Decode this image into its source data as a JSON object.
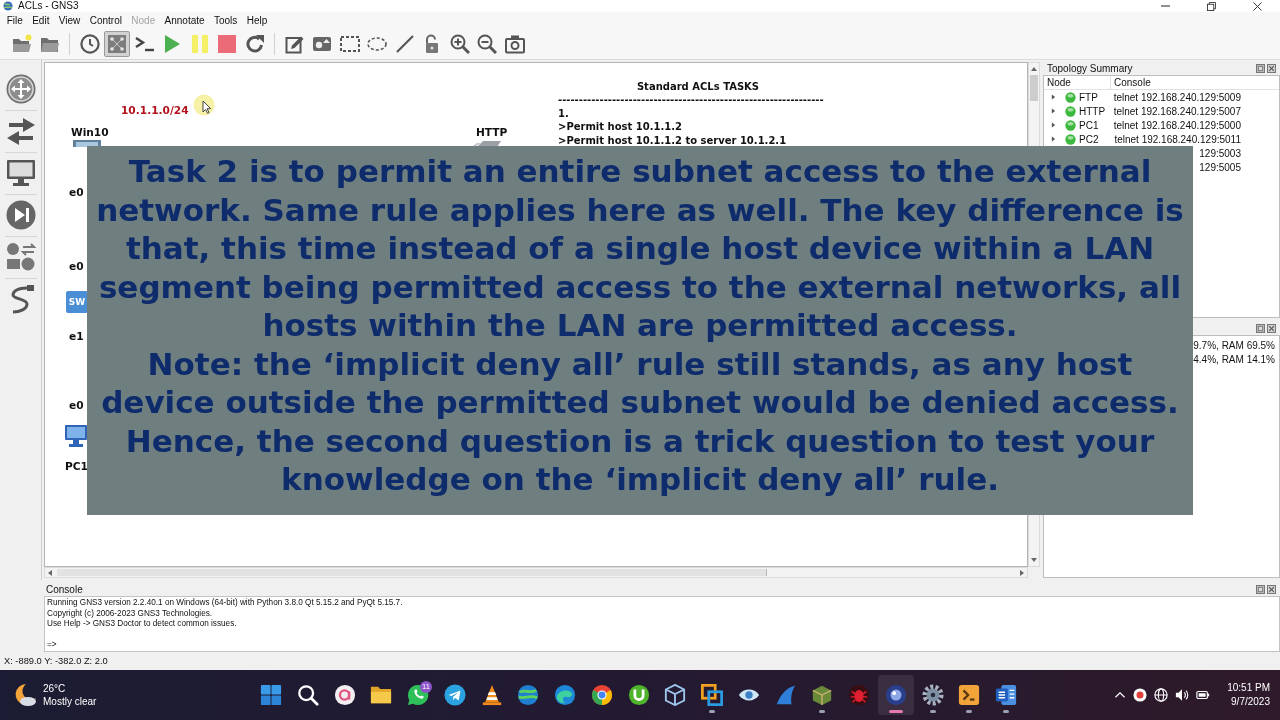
{
  "window": {
    "title": "ACLs - GNS3"
  },
  "menu": [
    {
      "label": "File",
      "disabled": false
    },
    {
      "label": "Edit",
      "disabled": false
    },
    {
      "label": "View",
      "disabled": false
    },
    {
      "label": "Control",
      "disabled": false
    },
    {
      "label": "Node",
      "disabled": true
    },
    {
      "label": "Annotate",
      "disabled": false
    },
    {
      "label": "Tools",
      "disabled": false
    },
    {
      "label": "Help",
      "disabled": false
    }
  ],
  "toolbar": [
    {
      "kind": "open",
      "pressed": false
    },
    {
      "kind": "folder",
      "pressed": false
    },
    {
      "kind": "clock",
      "pressed": false
    },
    {
      "kind": "labels",
      "pressed": true
    },
    {
      "kind": "console",
      "pressed": false
    },
    {
      "kind": "start",
      "pressed": false
    },
    {
      "kind": "pause",
      "pressed": false
    },
    {
      "kind": "stop",
      "pressed": false
    },
    {
      "kind": "reload",
      "pressed": false
    },
    {
      "kind": "note",
      "pressed": false
    },
    {
      "kind": "image",
      "pressed": false
    },
    {
      "kind": "rectangle",
      "pressed": false
    },
    {
      "kind": "ellipse",
      "pressed": false
    },
    {
      "kind": "line",
      "pressed": false
    },
    {
      "kind": "lock",
      "pressed": false
    },
    {
      "kind": "zoomin",
      "pressed": false
    },
    {
      "kind": "zoomout",
      "pressed": false
    },
    {
      "kind": "screenshot",
      "pressed": false
    }
  ],
  "canvas": {
    "items": [
      {
        "kind": "note",
        "text": "10.1.1.0/24"
      },
      {
        "kind": "label",
        "text": "Win10"
      },
      {
        "kind": "label",
        "text": "HTTP"
      },
      {
        "kind": "port",
        "text": "e0"
      },
      {
        "kind": "port",
        "text": "e0"
      },
      {
        "kind": "switch",
        "text": "SW"
      },
      {
        "kind": "port",
        "text": "e1"
      },
      {
        "kind": "port",
        "text": "e0"
      },
      {
        "kind": "label",
        "text": "PC1"
      }
    ],
    "tasks": {
      "title": "Standard ACLs TASKS",
      "rule": "----------------------------------------------------------------",
      "lines": [
        "1.",
        ">Permit host 10.1.1.2",
        ">Permit host 10.1.1.2 to server 10.1.2.1"
      ]
    }
  },
  "caption": {
    "paragraphs": [
      "Task 2 is to permit an entire subnet access to the external network. Same rule applies here as well. The key difference is that, this time instead of a single host device within a LAN segment being permitted access to the external networks, all hosts within the LAN are permitted access.",
      "Note: the ‘implicit deny all’ rule still stands, as any host device outside the permitted subnet would be denied access. Hence, the second question is a trick question to test your knowledge on the ‘implicit deny all’ rule."
    ]
  },
  "topology": {
    "title": "Topology Summary",
    "columns": [
      "Node",
      "Console"
    ],
    "rows": [
      {
        "node": "FTP",
        "console": "telnet 192.168.240.129:5009",
        "running": true,
        "expanded": false
      },
      {
        "node": "HTTP",
        "console": "telnet 192.168.240.129:5007",
        "running": true,
        "expanded": false
      },
      {
        "node": "PC1",
        "console": "telnet 192.168.240.129:5000",
        "running": true,
        "expanded": false
      },
      {
        "node": "PC2",
        "console": "telnet 192.168.240.129:5011",
        "running": true,
        "expanded": false
      },
      {
        "console": "129:5003"
      },
      {
        "console": "129:5005"
      }
    ]
  },
  "servers": {
    "rows": [
      "9.7%, RAM 69.5%",
      "4.4%, RAM 14.1%"
    ]
  },
  "console": {
    "title": "Console",
    "lines": [
      "Running GNS3 version 2.2.40.1 on Windows (64-bit) with Python 3.8.0 Qt 5.15.2 and PyQt 5.15.7.",
      "Copyright (c) 2006-2023 GNS3 Technologies.",
      "Use Help -> GNS3 Doctor to detect common issues."
    ],
    "prompt": "=>"
  },
  "status_bar": "X: -889.0 Y: -382.0 Z: 2.0",
  "taskbar": {
    "weather": {
      "temperature": "26°C",
      "condition": "Mostly clear"
    },
    "apps": [
      {
        "kind": "start",
        "running": false,
        "selected": false
      },
      {
        "kind": "search",
        "running": false,
        "selected": false
      },
      {
        "kind": "ring",
        "running": false,
        "selected": false
      },
      {
        "kind": "folder",
        "running": false,
        "selected": false
      },
      {
        "kind": "chat",
        "running": false,
        "selected": false,
        "badge": "11"
      },
      {
        "kind": "plane",
        "running": false,
        "selected": false
      },
      {
        "kind": "cone",
        "running": false,
        "selected": false
      },
      {
        "kind": "globe",
        "running": false,
        "selected": false
      },
      {
        "kind": "swirl",
        "running": false,
        "selected": false
      },
      {
        "kind": "disc",
        "running": false,
        "selected": false
      },
      {
        "kind": "download",
        "running": false,
        "selected": false
      },
      {
        "kind": "cube",
        "running": false,
        "selected": false
      },
      {
        "kind": "squares",
        "running": true,
        "selected": false
      },
      {
        "kind": "eye",
        "running": false,
        "selected": false
      },
      {
        "kind": "fin",
        "running": false,
        "selected": false
      },
      {
        "kind": "package",
        "running": true,
        "selected": false
      },
      {
        "kind": "bug",
        "running": false,
        "selected": false
      },
      {
        "kind": "orb",
        "running": true,
        "selected": true
      },
      {
        "kind": "gear",
        "running": true,
        "selected": false
      },
      {
        "kind": "terminal",
        "running": true,
        "selected": false
      },
      {
        "kind": "document",
        "running": true,
        "selected": false
      }
    ],
    "clock": {
      "time": "10:51 PM",
      "date": "9/7/2023"
    }
  }
}
